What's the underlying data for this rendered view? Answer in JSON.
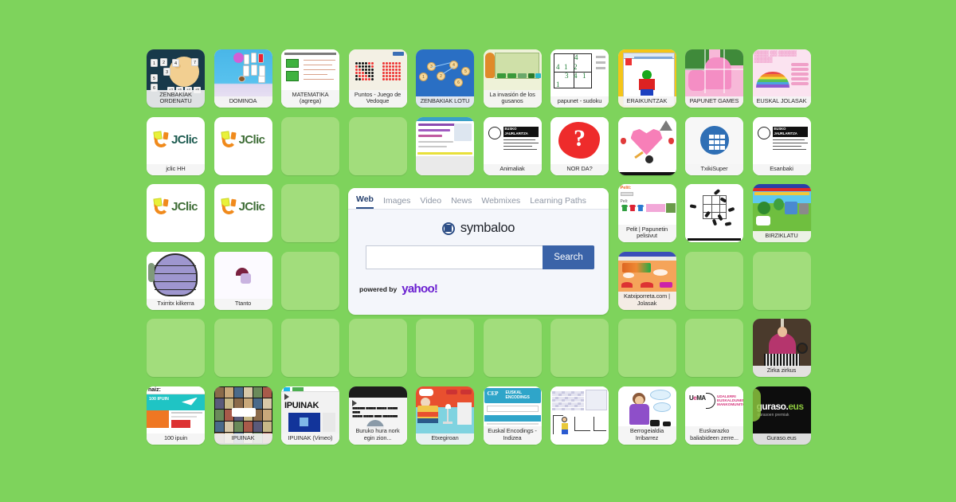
{
  "page": {
    "background_color": "#7ed35c",
    "empty_tile_color": "#a2dd7c"
  },
  "search_widget": {
    "name": "symbaloo-search",
    "brand": "symbaloo",
    "tabs": [
      {
        "label": "Web",
        "active": true
      },
      {
        "label": "Images",
        "active": false
      },
      {
        "label": "Video",
        "active": false
      },
      {
        "label": "News",
        "active": false
      },
      {
        "label": "Webmixes",
        "active": false
      },
      {
        "label": "Learning Paths",
        "active": false
      }
    ],
    "input_value": "",
    "input_placeholder": "",
    "search_button": "Search",
    "powered_by_label": "powered by",
    "powered_by_brand": "yahoo!",
    "accent_color": "#3a63a8"
  },
  "tiles": [
    {
      "row": 1,
      "col": 1,
      "label": "ZENBAKIAK ORDENATU",
      "kind": "zenbakiak-ordenatu"
    },
    {
      "row": 1,
      "col": 2,
      "label": "DOMINOA",
      "kind": "dominoa"
    },
    {
      "row": 1,
      "col": 3,
      "label": "MATEMATIKA (agrega)",
      "kind": "matematika"
    },
    {
      "row": 1,
      "col": 4,
      "label": "Puntos - Juego de Vedoque",
      "kind": "puntos"
    },
    {
      "row": 1,
      "col": 5,
      "label": "ZENBAKIAK LOTU",
      "kind": "zenbakiak-lotu"
    },
    {
      "row": 1,
      "col": 6,
      "label": "La invasión de los gusanos",
      "kind": "gusanos"
    },
    {
      "row": 1,
      "col": 7,
      "label": "papunet - sudoku",
      "kind": "sudoku"
    },
    {
      "row": 1,
      "col": 8,
      "label": "ERAIKUNTZAK",
      "kind": "eraikuntzak"
    },
    {
      "row": 1,
      "col": 9,
      "label": "PAPUNET GAMES",
      "kind": "papunet-games"
    },
    {
      "row": 1,
      "col": 10,
      "label": "EUSKAL JOLASAK",
      "kind": "euskal-jolasak"
    },
    {
      "row": 2,
      "col": 1,
      "label": "jclic HH",
      "kind": "jclic-white"
    },
    {
      "row": 2,
      "col": 2,
      "label": "",
      "kind": "jclic-green"
    },
    {
      "row": 2,
      "col": 3,
      "label": "",
      "kind": "empty"
    },
    {
      "row": 2,
      "col": 4,
      "label": "",
      "kind": "empty"
    },
    {
      "row": 2,
      "col": 5,
      "label": "",
      "kind": "website-doc"
    },
    {
      "row": 2,
      "col": 6,
      "label": "Animaliak",
      "kind": "gobierno-vasco"
    },
    {
      "row": 2,
      "col": 7,
      "label": "NOR DA?",
      "kind": "nor-da"
    },
    {
      "row": 2,
      "col": 8,
      "label": "",
      "kind": "heart"
    },
    {
      "row": 2,
      "col": 9,
      "label": "TxikiSuper",
      "kind": "txikisuper"
    },
    {
      "row": 2,
      "col": 10,
      "label": "Esanbaki",
      "kind": "gobierno-vasco"
    },
    {
      "row": 3,
      "col": 1,
      "label": "",
      "kind": "jclic-green"
    },
    {
      "row": 3,
      "col": 2,
      "label": "",
      "kind": "jclic-green"
    },
    {
      "row": 3,
      "col": 3,
      "label": "",
      "kind": "empty"
    },
    {
      "row": 3,
      "col": 8,
      "label": "Pelit | Papunetin pelisivut",
      "kind": "pelit-papunet"
    },
    {
      "row": 3,
      "col": 9,
      "label": "",
      "kind": "ants"
    },
    {
      "row": 3,
      "col": 10,
      "label": "BIRZIKLATU",
      "kind": "birziklatu"
    },
    {
      "row": 4,
      "col": 1,
      "label": "Txirritx kilkerra",
      "kind": "txirritx"
    },
    {
      "row": 4,
      "col": 2,
      "label": "Ttanto",
      "kind": "ttanto"
    },
    {
      "row": 4,
      "col": 3,
      "label": "",
      "kind": "empty"
    },
    {
      "row": 4,
      "col": 8,
      "label": "Katxiporreta.com | Jolasak",
      "kind": "katxiporreta"
    },
    {
      "row": 4,
      "col": 9,
      "label": "",
      "kind": "empty"
    },
    {
      "row": 4,
      "col": 10,
      "label": "",
      "kind": "empty"
    },
    {
      "row": 5,
      "col": 1,
      "label": "",
      "kind": "empty"
    },
    {
      "row": 5,
      "col": 2,
      "label": "",
      "kind": "empty"
    },
    {
      "row": 5,
      "col": 3,
      "label": "",
      "kind": "empty"
    },
    {
      "row": 5,
      "col": 4,
      "label": "",
      "kind": "empty"
    },
    {
      "row": 5,
      "col": 5,
      "label": "",
      "kind": "empty"
    },
    {
      "row": 5,
      "col": 6,
      "label": "",
      "kind": "empty"
    },
    {
      "row": 5,
      "col": 7,
      "label": "",
      "kind": "empty"
    },
    {
      "row": 5,
      "col": 8,
      "label": "",
      "kind": "empty"
    },
    {
      "row": 5,
      "col": 9,
      "label": "",
      "kind": "empty"
    },
    {
      "row": 5,
      "col": 10,
      "label": "Zirka zirkus",
      "kind": "zirka-zirkus"
    },
    {
      "row": 6,
      "col": 1,
      "label": "100 ipuin",
      "kind": "naiz-ipuin"
    },
    {
      "row": 6,
      "col": 2,
      "label": "IPUINAK",
      "kind": "ipuinak-grid"
    },
    {
      "row": 6,
      "col": 3,
      "label": "IPUINAK (Vimeo)",
      "kind": "ipuinak-vimeo"
    },
    {
      "row": 6,
      "col": 4,
      "label": "Buruko hura nork egin zion...",
      "kind": "buruko-hura"
    },
    {
      "row": 6,
      "col": 5,
      "label": "Etxegiroan",
      "kind": "etxegiroan"
    },
    {
      "row": 6,
      "col": 6,
      "label": "Euskal Encodings - Indizea",
      "kind": "euskal-encodings"
    },
    {
      "row": 6,
      "col": 7,
      "label": "",
      "kind": "spreadsheet"
    },
    {
      "row": 6,
      "col": 8,
      "label": "Berrogeialdia Irribarrez",
      "kind": "berrogeialdia"
    },
    {
      "row": 6,
      "col": 9,
      "label": "Euskarazko baliabideen zerre...",
      "kind": "uema"
    },
    {
      "row": 6,
      "col": 10,
      "label": "Guraso.eus",
      "kind": "guraso"
    }
  ]
}
